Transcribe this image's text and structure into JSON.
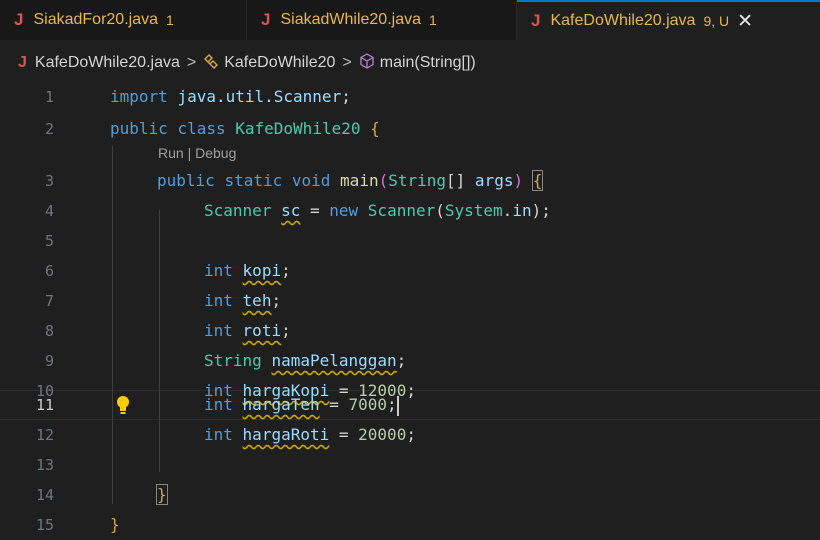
{
  "tabs": [
    {
      "label": "SiakadFor20.java",
      "badge": "1",
      "icon": "java-file-icon"
    },
    {
      "label": "SiakadWhile20.java",
      "badge": "1",
      "icon": "java-file-icon"
    },
    {
      "label": "KafeDoWhile20.java",
      "badge": "9, U",
      "icon": "java-file-icon",
      "active": true,
      "close": "✕"
    }
  ],
  "breadcrumb": {
    "file": "KafeDoWhile20.java",
    "class": "KafeDoWhile20",
    "method": "main(String[])",
    "separator": ">"
  },
  "codelens": "Run | Debug",
  "line_numbers": [
    "1",
    "2",
    "3",
    "4",
    "5",
    "6",
    "7",
    "8",
    "9",
    "10",
    "11",
    "12",
    "13",
    "14",
    "15"
  ],
  "current_line": "11",
  "code": {
    "l1": {
      "kw": "import",
      "pkg": "java.util.Scanner",
      "semi": ";"
    },
    "l2": {
      "kw1": "public",
      "kw2": "class",
      "name": "KafeDoWhile20",
      "brace": "{"
    },
    "l3": {
      "kw1": "public",
      "kw2": "static",
      "kw3": "void",
      "fn": "main",
      "p1": "(",
      "type": "String",
      "arr": "[]",
      "param": "args",
      "p2": ")",
      "brace": "{"
    },
    "l4": {
      "type": "Scanner",
      "var": "sc",
      "eq": " = ",
      "kw": "new",
      "type2": "Scanner",
      "p1": "(",
      "sys": "System",
      "dot": ".",
      "in": "in",
      "p2": ");"
    },
    "l6": {
      "kw": "int",
      "var": "kopi",
      "semi": ";"
    },
    "l7": {
      "kw": "int",
      "var": "teh",
      "semi": ";"
    },
    "l8": {
      "kw": "int",
      "var": "roti",
      "semi": ";"
    },
    "l9": {
      "type": "String",
      "var": "namaPelanggan",
      "semi": ";"
    },
    "l10": {
      "kw": "int",
      "var": "hargaKopi",
      "eq": " = ",
      "num": "12000",
      "semi": ";"
    },
    "l11": {
      "kw": "int",
      "var": "hargaTeh",
      "eq": " = ",
      "num": "7000",
      "semi": ";"
    },
    "l12": {
      "kw": "int",
      "var": "hargaRoti",
      "eq": " = ",
      "num": "20000",
      "semi": ";"
    },
    "l14": {
      "brace": "}"
    },
    "l15": {
      "brace": "}"
    }
  },
  "colors": {
    "accent": "#0078d4",
    "tab_text": "#e8b84a",
    "java_icon": "#e2514c",
    "keyword": "#569cd6",
    "type": "#4ec9b0",
    "number": "#b5cea8"
  }
}
